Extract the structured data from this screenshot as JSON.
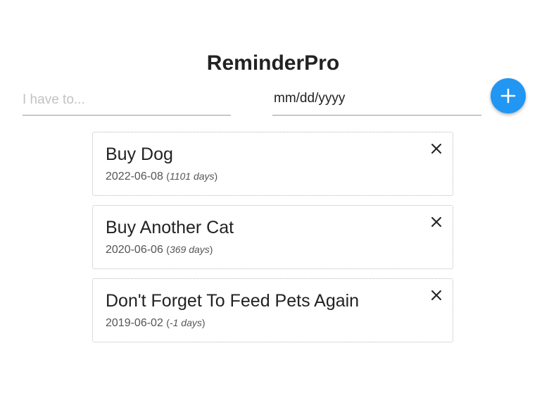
{
  "app": {
    "title": "ReminderPro"
  },
  "form": {
    "task_placeholder": "I have to...",
    "task_value": "",
    "date_placeholder": "mm/dd/yyyy",
    "add_icon": "plus-icon",
    "accent_color": "#2196f3"
  },
  "reminders": [
    {
      "title": "Buy Dog",
      "date": "2022-06-08",
      "days_open": "(",
      "days": "1101 days",
      "days_close": ")",
      "close_icon": "close-icon"
    },
    {
      "title": "Buy Another Cat",
      "date": "2020-06-06",
      "days_open": "(",
      "days": "369 days",
      "days_close": ")",
      "close_icon": "close-icon"
    },
    {
      "title": "Don't Forget To Feed Pets Again",
      "date": "2019-06-02",
      "days_open": "(",
      "days": "-1 days",
      "days_close": ")",
      "close_icon": "close-icon"
    }
  ]
}
